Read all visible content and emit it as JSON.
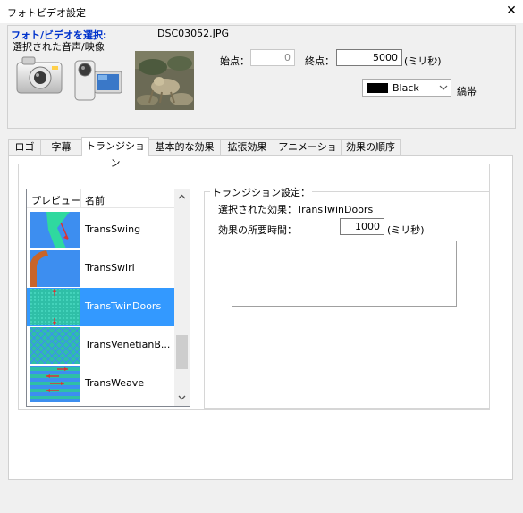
{
  "window": {
    "title": "フォトビデオ設定",
    "close_glyph": "✕"
  },
  "media": {
    "select_label": "フォト/ビデオを選択:",
    "filename": "DSC03052.JPG",
    "group_label": "選択された音声/映像"
  },
  "timing": {
    "start_label": "始点：",
    "start_value": "0",
    "end_label": "終点：",
    "end_value": "5000",
    "end_unit": "(ミリ秒)"
  },
  "border": {
    "color_name": "Black",
    "color_hex": "#000000",
    "label": "縞帯"
  },
  "tabs": [
    {
      "label": "ロゴ"
    },
    {
      "label": "字幕"
    },
    {
      "label": "トランジション"
    },
    {
      "label": "基本的な効果"
    },
    {
      "label": "拡張効果"
    },
    {
      "label": "アニメーション"
    },
    {
      "label": "効果の順序"
    }
  ],
  "transitions": {
    "col_preview": "プレビュー",
    "col_name": "名前",
    "items": [
      {
        "name": "TransSwing"
      },
      {
        "name": "TransSwirl"
      },
      {
        "name": "TransTwinDoors",
        "selected": true
      },
      {
        "name": "TransVenetianB..."
      },
      {
        "name": "TransWeave"
      }
    ]
  },
  "settings": {
    "group_title": "トランジション設定：",
    "selected_effect_label": "選択された効果：TransTwinDoors",
    "duration_label": "効果の所要時間：",
    "duration_value": "1000",
    "duration_unit": "(ミリ秒)"
  },
  "icons": {
    "camera": "camera-icon",
    "camcorder": "camcorder-icon",
    "close": "close-icon",
    "chevron": "chevron-down-icon",
    "scroll_up": "chevron-up-icon",
    "scroll_down": "chevron-down-icon"
  },
  "colors": {
    "select_label": "#0033cc",
    "selection": "#3399ff",
    "preview_teal": "#2fbfa7",
    "preview_blue": "#3d8ef0"
  }
}
